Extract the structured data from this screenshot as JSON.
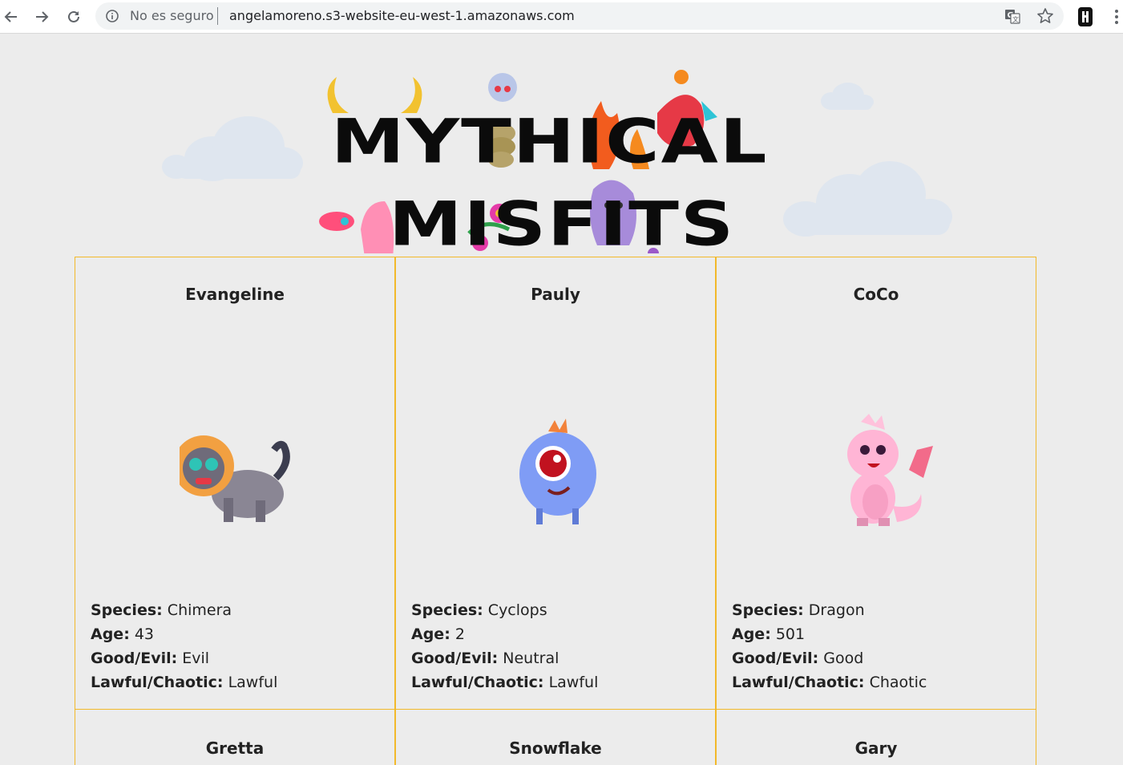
{
  "browser": {
    "security_label": "No es seguro",
    "url": "angelamoreno.s3-website-eu-west-1.amazonaws.com"
  },
  "logo": {
    "line1": "MYTHICAL",
    "line2": "MISFITS"
  },
  "labels": {
    "species": "Species:",
    "age": "Age:",
    "good_evil": "Good/Evil:",
    "lawful_chaotic": "Lawful/Chaotic:"
  },
  "cards": [
    {
      "name": "Evangeline",
      "species": "Chimera",
      "age": "43",
      "good_evil": "Evil",
      "lawful_chaotic": "Lawful",
      "image": "chimera-illustration"
    },
    {
      "name": "Pauly",
      "species": "Cyclops",
      "age": "2",
      "good_evil": "Neutral",
      "lawful_chaotic": "Lawful",
      "image": "cyclops-illustration"
    },
    {
      "name": "CoCo",
      "species": "Dragon",
      "age": "501",
      "good_evil": "Good",
      "lawful_chaotic": "Chaotic",
      "image": "dragon-illustration"
    },
    {
      "name": "Gretta"
    },
    {
      "name": "Snowflake"
    },
    {
      "name": "Gary"
    }
  ],
  "colors": {
    "card_border": "#f2b92b",
    "page_bg": "#ececec"
  }
}
